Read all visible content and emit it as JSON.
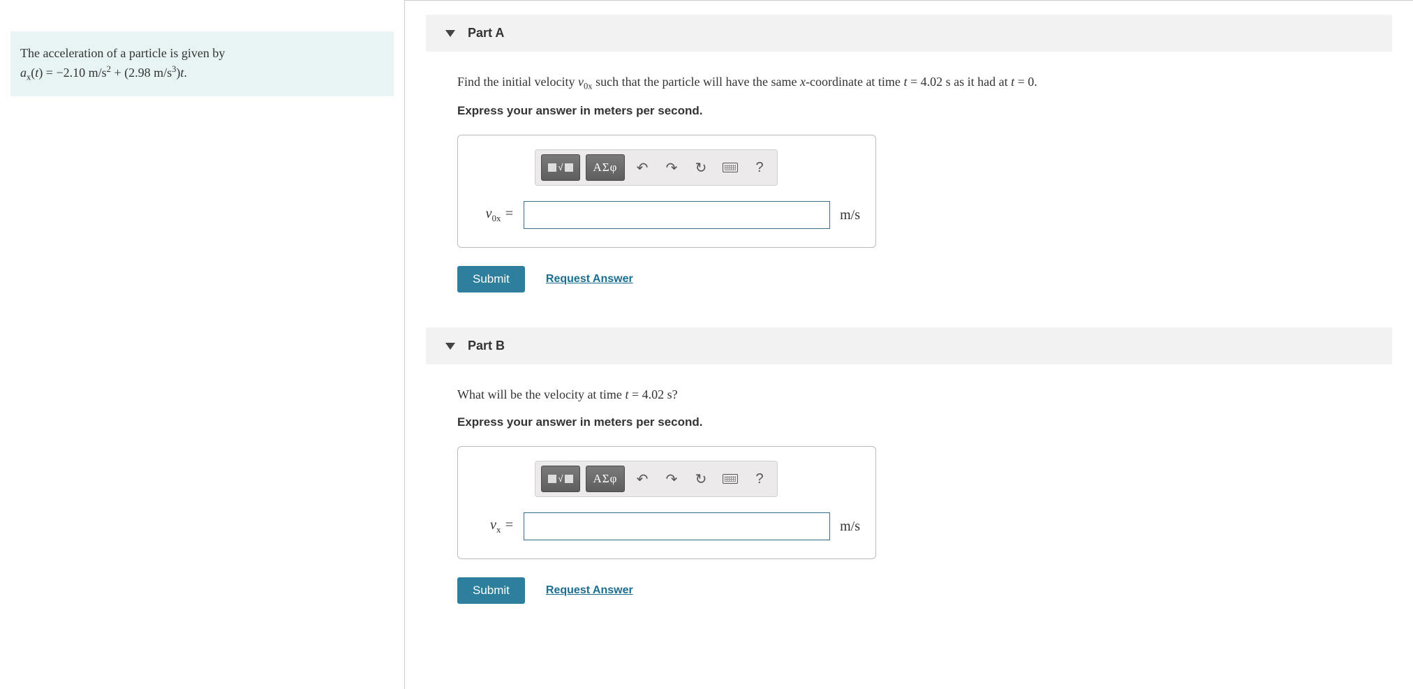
{
  "problem": {
    "intro": "The acceleration of a particle is given by",
    "eq_lhs_var": "a",
    "eq_lhs_sub": "x",
    "eq_lhs_arg": "t",
    "eq_c1": "−2.10",
    "eq_u1a": "m/s",
    "eq_u1exp": "2",
    "eq_plus": " + (",
    "eq_c2": "2.98",
    "eq_u2a": "m/s",
    "eq_u2exp": "3",
    "eq_close": ")",
    "eq_tvar": "t",
    "eq_end": "."
  },
  "toolbar": {
    "greek": "ΑΣφ",
    "help": "?"
  },
  "partA": {
    "title": "Part A",
    "p_pre": "Find the initial velocity ",
    "p_var": "v",
    "p_sub": "0x",
    "p_mid1": " such that the particle will have the same ",
    "p_xital": "x",
    "p_mid2": "-coordinate at time ",
    "p_t1v": "t",
    "p_eq1": " = 4.02 ",
    "p_s1": "s",
    "p_mid3": " as it had at ",
    "p_t2v": "t",
    "p_eq2": " = 0.",
    "instruct": "Express your answer in meters per second.",
    "label_var": "v",
    "label_sub": "0x",
    "label_eq": " =",
    "unit": "m/s",
    "submit": "Submit",
    "request": "Request Answer"
  },
  "partB": {
    "title": "Part B",
    "p_pre": "What will be the velocity at time ",
    "p_tv": "t",
    "p_eq": " = 4.02 ",
    "p_s": "s",
    "p_post": "?",
    "instruct": "Express your answer in meters per second.",
    "label_var": "v",
    "label_sub": "x",
    "label_eq": " =",
    "unit": "m/s",
    "submit": "Submit",
    "request": "Request Answer"
  }
}
